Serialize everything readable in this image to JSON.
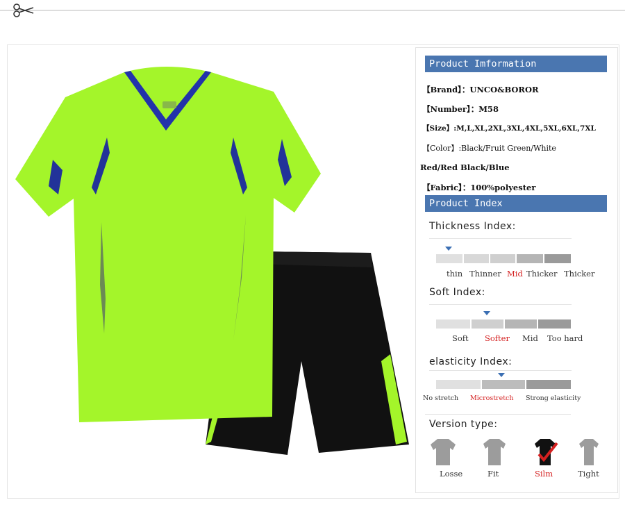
{
  "header": {
    "scissors_icon": "scissors-icon"
  },
  "product_image": {
    "alt": "green t-shirt and black shorts set"
  },
  "info_section": {
    "title": "Product Imformation",
    "brand": "【Brand】：UNCO&BOROR",
    "number": "【Number】：M58",
    "size": "【Size】:M,L,XL,2XL,3XL,4XL,5XL,6XL,7XL",
    "color": "【Color】:Black/Fruit Green/White",
    "color_cont": "Red/Red Black/Blue",
    "fabric": "【Fabric】：100%polyester"
  },
  "index_section": {
    "title": "Product Index",
    "thickness": {
      "title": "Thickness Index:",
      "labels": [
        "thin",
        "Thinner",
        "Mid",
        "Thicker",
        "Thicker"
      ],
      "selected": "Mid"
    },
    "soft": {
      "title": "Soft Index:",
      "labels": [
        "Soft",
        "Softer",
        "Mid",
        "Too hard"
      ],
      "selected": "Softer"
    },
    "elasticity": {
      "title": "elasticity Index:",
      "labels": [
        "No stretch",
        "Microstretch",
        "Strong elasticity"
      ],
      "selected": "Microstretch"
    },
    "version": {
      "title": "Version type:",
      "labels": [
        "Losse",
        "Fit",
        "Silm",
        "Tight"
      ],
      "selected": "Silm"
    }
  },
  "colors": {
    "accent_blue": "#4a76b0",
    "highlight_red": "#d42020",
    "shirt_green": "#a4f52a",
    "shorts_black": "#111111"
  }
}
